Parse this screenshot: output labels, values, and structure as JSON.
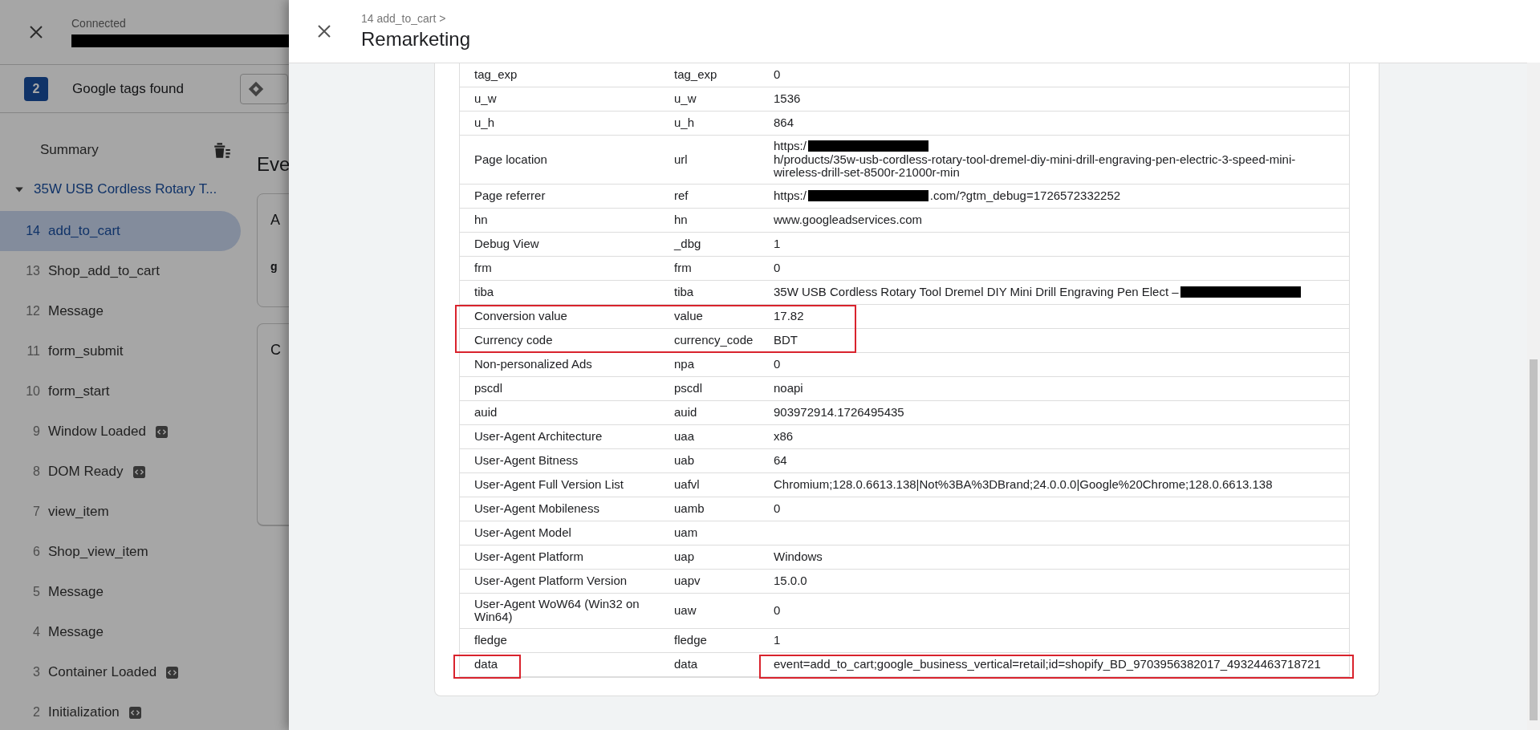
{
  "background": {
    "header": {
      "status": "Connected"
    },
    "tags_bar": {
      "count": "2",
      "label": "Google tags found"
    },
    "sidebar": {
      "summary": "Summary",
      "group": {
        "label": "35W USB Cordless Rotary T...",
        "expanded": true
      },
      "items": [
        {
          "number": "14",
          "label": "add_to_cart",
          "selected": true,
          "code_badge": false
        },
        {
          "number": "13",
          "label": "Shop_add_to_cart",
          "selected": false,
          "code_badge": false
        },
        {
          "number": "12",
          "label": "Message",
          "selected": false,
          "code_badge": false
        },
        {
          "number": "11",
          "label": "form_submit",
          "selected": false,
          "code_badge": false
        },
        {
          "number": "10",
          "label": "form_start",
          "selected": false,
          "code_badge": false
        },
        {
          "number": "9",
          "label": "Window Loaded",
          "selected": false,
          "code_badge": true
        },
        {
          "number": "8",
          "label": "DOM Ready",
          "selected": false,
          "code_badge": true
        },
        {
          "number": "7",
          "label": "view_item",
          "selected": false,
          "code_badge": false
        },
        {
          "number": "6",
          "label": "Shop_view_item",
          "selected": false,
          "code_badge": false
        },
        {
          "number": "5",
          "label": "Message",
          "selected": false,
          "code_badge": false
        },
        {
          "number": "4",
          "label": "Message",
          "selected": false,
          "code_badge": false
        },
        {
          "number": "3",
          "label": "Container Loaded",
          "selected": false,
          "code_badge": true
        },
        {
          "number": "2",
          "label": "Initialization",
          "selected": false,
          "code_badge": true
        }
      ]
    },
    "main": {
      "heading": "Eve",
      "card_1": {
        "title": "A",
        "text": "g"
      },
      "card_2": {
        "title": "C"
      }
    }
  },
  "drawer": {
    "breadcrumb": "14 add_to_cart >",
    "title": "Remarketing",
    "rows": [
      {
        "label": "tag_exp",
        "param": "tag_exp",
        "value": "0"
      },
      {
        "label": "u_w",
        "param": "u_w",
        "value": "1536"
      },
      {
        "label": "u_h",
        "param": "u_h",
        "value": "864"
      },
      {
        "label": "Page location",
        "param": "url",
        "value_parts": [
          {
            "kind": "text",
            "text": "https:/"
          },
          {
            "kind": "redacted"
          },
          {
            "kind": "text",
            "text": "h/products/35w-usb-cordless-rotary-tool-dremel-diy-mini-drill-engraving-pen-electric-3-speed-mini-wireless-drill-set-8500r-21000r-min"
          }
        ]
      },
      {
        "label": "Page referrer",
        "param": "ref",
        "value_parts": [
          {
            "kind": "text",
            "text": "https:/"
          },
          {
            "kind": "redacted"
          },
          {
            "kind": "text",
            "text": ".com/?gtm_debug=1726572332252"
          }
        ]
      },
      {
        "label": "hn",
        "param": "hn",
        "value": "www.googleadservices.com"
      },
      {
        "label": "Debug View",
        "param": "_dbg",
        "value": "1"
      },
      {
        "label": "frm",
        "param": "frm",
        "value": "0"
      },
      {
        "label": "tiba",
        "param": "tiba",
        "value_parts": [
          {
            "kind": "text",
            "text": "35W USB Cordless Rotary Tool Dremel DIY Mini Drill Engraving Pen Elect –"
          },
          {
            "kind": "redacted"
          }
        ]
      },
      {
        "label": "Conversion value",
        "param": "value",
        "value": "17.82",
        "outline_label_param": true
      },
      {
        "label": "Currency code",
        "param": "currency_code",
        "value": "BDT",
        "outline_label_param": true
      },
      {
        "label": "Non-personalized Ads",
        "param": "npa",
        "value": "0"
      },
      {
        "label": "pscdl",
        "param": "pscdl",
        "value": "noapi"
      },
      {
        "label": "auid",
        "param": "auid",
        "value": "903972914.1726495435"
      },
      {
        "label": "User-Agent Architecture",
        "param": "uaa",
        "value": "x86"
      },
      {
        "label": "User-Agent Bitness",
        "param": "uab",
        "value": "64"
      },
      {
        "label": "User-Agent Full Version List",
        "param": "uafvl",
        "value": "Chromium;128.0.6613.138|Not%3BA%3DBrand;24.0.0.0|Google%20Chrome;128.0.6613.138"
      },
      {
        "label": "User-Agent Mobileness",
        "param": "uamb",
        "value": "0"
      },
      {
        "label": "User-Agent Model",
        "param": "uam"
      },
      {
        "label": "User-Agent Platform",
        "param": "uap",
        "value": "Windows"
      },
      {
        "label": "User-Agent Platform Version",
        "param": "uapv",
        "value": "15.0.0"
      },
      {
        "label": "User-Agent WoW64 (Win32 on Win64)",
        "param": "uaw",
        "value": "0"
      },
      {
        "label": "fledge",
        "param": "fledge",
        "value": "1"
      },
      {
        "label": "data",
        "param": "data",
        "value": "event=add_to_cart;google_business_vertical=retail;id=shopify_BD_9703956382017_49324463718721",
        "outline_label": true,
        "outline_value": true
      }
    ]
  }
}
